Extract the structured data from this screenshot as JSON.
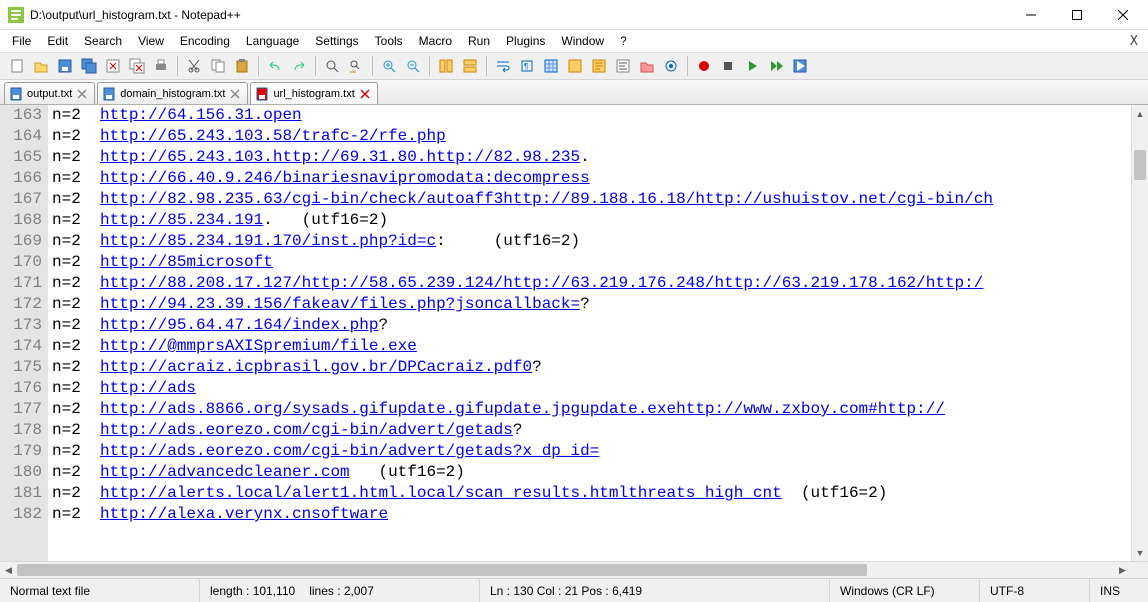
{
  "window": {
    "title": "D:\\output\\url_histogram.txt - Notepad++"
  },
  "menus": [
    "File",
    "Edit",
    "Search",
    "View",
    "Encoding",
    "Language",
    "Settings",
    "Tools",
    "Macro",
    "Run",
    "Plugins",
    "Window",
    "?"
  ],
  "toolbar_icons": [
    "new-icon",
    "open-icon",
    "save-icon",
    "save-all-icon",
    "close-icon",
    "close-all-icon",
    "print-icon",
    "sep",
    "cut-icon",
    "copy-icon",
    "paste-icon",
    "sep",
    "undo-icon",
    "redo-icon",
    "sep",
    "find-icon",
    "replace-icon",
    "sep",
    "zoom-in-icon",
    "zoom-out-icon",
    "sep",
    "sync-v-icon",
    "sync-h-icon",
    "sep",
    "wrap-icon",
    "show-all-icon",
    "indent-guide-icon",
    "udl-icon",
    "doc-map-icon",
    "func-list-icon",
    "folder-icon",
    "monitor-icon",
    "sep",
    "record-icon",
    "stop-icon",
    "play-icon",
    "play-multi-icon",
    "save-macro-icon"
  ],
  "tabs": [
    {
      "label": "output.txt",
      "active": false,
      "dirty": false
    },
    {
      "label": "domain_histogram.txt",
      "active": false,
      "dirty": false
    },
    {
      "label": "url_histogram.txt",
      "active": true,
      "dirty": true
    }
  ],
  "lines": [
    {
      "num": 163,
      "n": "n=2  ",
      "url": "http://64.156.31.open",
      "extra": ""
    },
    {
      "num": 164,
      "n": "n=2  ",
      "url": "http://65.243.103.58/trafc-2/rfe.php",
      "extra": ""
    },
    {
      "num": 165,
      "n": "n=2  ",
      "url": "http://65.243.103.http://69.31.80.http://82.98.235",
      "extra": "."
    },
    {
      "num": 166,
      "n": "n=2  ",
      "url": "http://66.40.9.246/binariesnavipromodata:decompress",
      "extra": ""
    },
    {
      "num": 167,
      "n": "n=2  ",
      "url": "http://82.98.235.63/cgi-bin/check/autoaff3http://89.188.16.18/http://ushuistov.net/cgi-bin/ch",
      "extra": ""
    },
    {
      "num": 168,
      "n": "n=2  ",
      "url": "http://85.234.191",
      "extra": ".   (utf16=2)"
    },
    {
      "num": 169,
      "n": "n=2  ",
      "url": "http://85.234.191.170/inst.php?id=c",
      "extra": ":     (utf16=2)"
    },
    {
      "num": 170,
      "n": "n=2  ",
      "url": "http://85microsoft",
      "extra": ""
    },
    {
      "num": 171,
      "n": "n=2  ",
      "url": "http://88.208.17.127/http://58.65.239.124/http://63.219.176.248/http://63.219.178.162/http:/",
      "extra": ""
    },
    {
      "num": 172,
      "n": "n=2  ",
      "url": "http://94.23.39.156/fakeav/files.php?jsoncallback=",
      "extra": "?"
    },
    {
      "num": 173,
      "n": "n=2  ",
      "url": "http://95.64.47.164/index.php",
      "extra": "?"
    },
    {
      "num": 174,
      "n": "n=2  ",
      "url": "http://@mmprsAXISpremium/file.exe",
      "extra": ""
    },
    {
      "num": 175,
      "n": "n=2  ",
      "url": "http://acraiz.icpbrasil.gov.br/DPCacraiz.pdf0",
      "extra": "?"
    },
    {
      "num": 176,
      "n": "n=2  ",
      "url": "http://ads",
      "extra": ""
    },
    {
      "num": 177,
      "n": "n=2  ",
      "url": "http://ads.8866.org/sysads.gifupdate.gifupdate.jpgupdate.exehttp://www.zxboy.com#http://",
      "extra": ""
    },
    {
      "num": 178,
      "n": "n=2  ",
      "url": "http://ads.eorezo.com/cgi-bin/advert/getads",
      "extra": "?"
    },
    {
      "num": 179,
      "n": "n=2  ",
      "url": "http://ads.eorezo.com/cgi-bin/advert/getads?x_dp_id=",
      "extra": ""
    },
    {
      "num": 180,
      "n": "n=2  ",
      "url": "http://advancedcleaner.com",
      "extra": "   (utf16=2)"
    },
    {
      "num": 181,
      "n": "n=2  ",
      "url": "http://alerts.local/alert1.html.local/scan_results.htmlthreats_high_cnt",
      "extra": "  (utf16=2)"
    },
    {
      "num": 182,
      "n": "n=2  ",
      "url": "http://alexa.verynx.cnsoftware",
      "extra": ""
    }
  ],
  "status": {
    "filetype": "Normal text file",
    "length_label": "length : 101,110",
    "lines_label": "lines : 2,007",
    "pos_label": "Ln : 130    Col : 21    Pos : 6,419",
    "eol": "Windows (CR LF)",
    "encoding": "UTF-8",
    "ins": "INS"
  }
}
